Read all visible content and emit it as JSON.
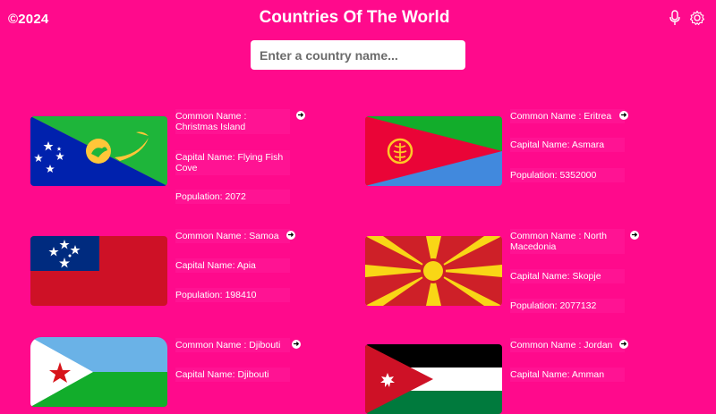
{
  "header": {
    "copyright": "©2024",
    "title": "Countries Of The World",
    "icons": [
      "microphone-icon",
      "gear-icon"
    ]
  },
  "search": {
    "placeholder": "Enter a country name...",
    "value": ""
  },
  "countries": [
    {
      "common": "Common Name : Christmas Island",
      "capital": "Capital Name: Flying Fish Cove",
      "population": "Population: 2072",
      "flag": "christmas-island-flag"
    },
    {
      "common": "Common Name : Eritrea",
      "capital": "Capital Name: Asmara",
      "population": "Population: 5352000",
      "flag": "eritrea-flag"
    },
    {
      "common": "Common Name : Samoa",
      "capital": "Capital Name: Apia",
      "population": "Population: 198410",
      "flag": "samoa-flag"
    },
    {
      "common": "Common Name : North Macedonia",
      "capital": "Capital Name: Skopje",
      "population": "Population: 2077132",
      "flag": "north-macedonia-flag"
    },
    {
      "common": "Common Name : Djibouti",
      "capital": "Capital Name: Djibouti",
      "population": "",
      "flag": "djibouti-flag"
    },
    {
      "common": "Common Name : Jordan",
      "capital": "Capital Name: Amman",
      "population": "",
      "flag": "jordan-flag"
    }
  ],
  "colors": {
    "background": "#ff0a8c",
    "search_bg": "#ffffff"
  }
}
